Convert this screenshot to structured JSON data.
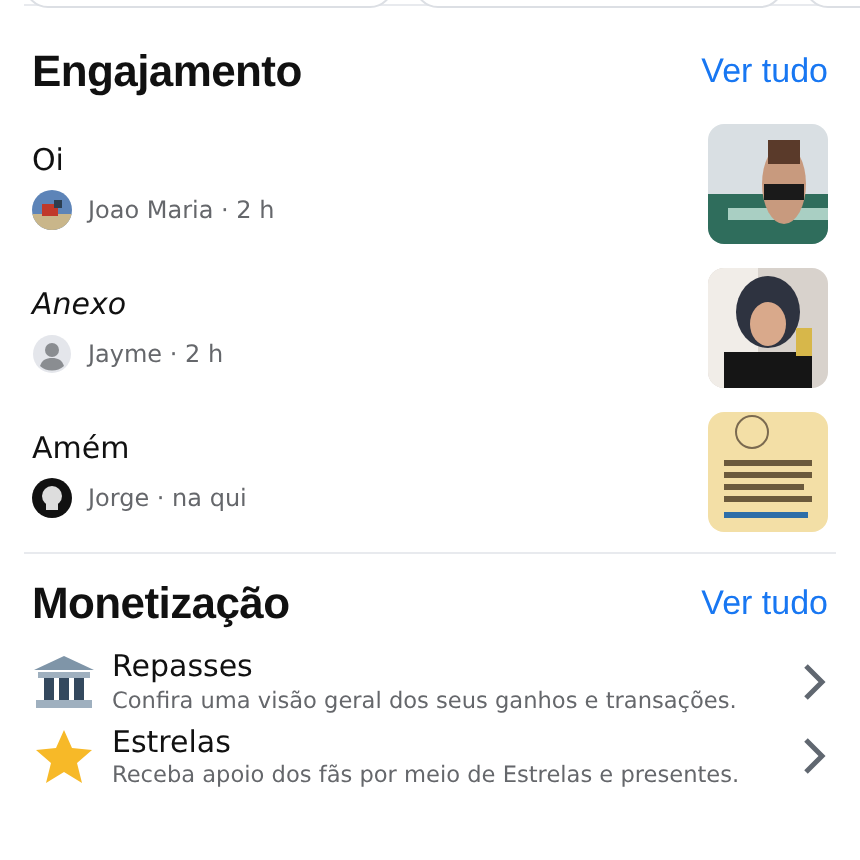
{
  "engagement": {
    "title": "Engajamento",
    "link": "Ver tudo",
    "posts": [
      {
        "title": "Oi",
        "italic": false,
        "author": "Joao Maria · 2 h"
      },
      {
        "title": "Anexo",
        "italic": true,
        "author": "Jayme · 2 h"
      },
      {
        "title": "Amém",
        "italic": false,
        "author": "Jorge · na qui"
      }
    ]
  },
  "monetization": {
    "title": "Monetização",
    "link": "Ver tudo",
    "items": [
      {
        "kind": "bank",
        "title": "Repasses",
        "subtitle": "Confira uma visão geral dos seus ganhos e transações."
      },
      {
        "kind": "star",
        "title": "Estrelas",
        "subtitle": "Receba apoio dos fãs por meio de Estrelas e presentes."
      }
    ]
  }
}
